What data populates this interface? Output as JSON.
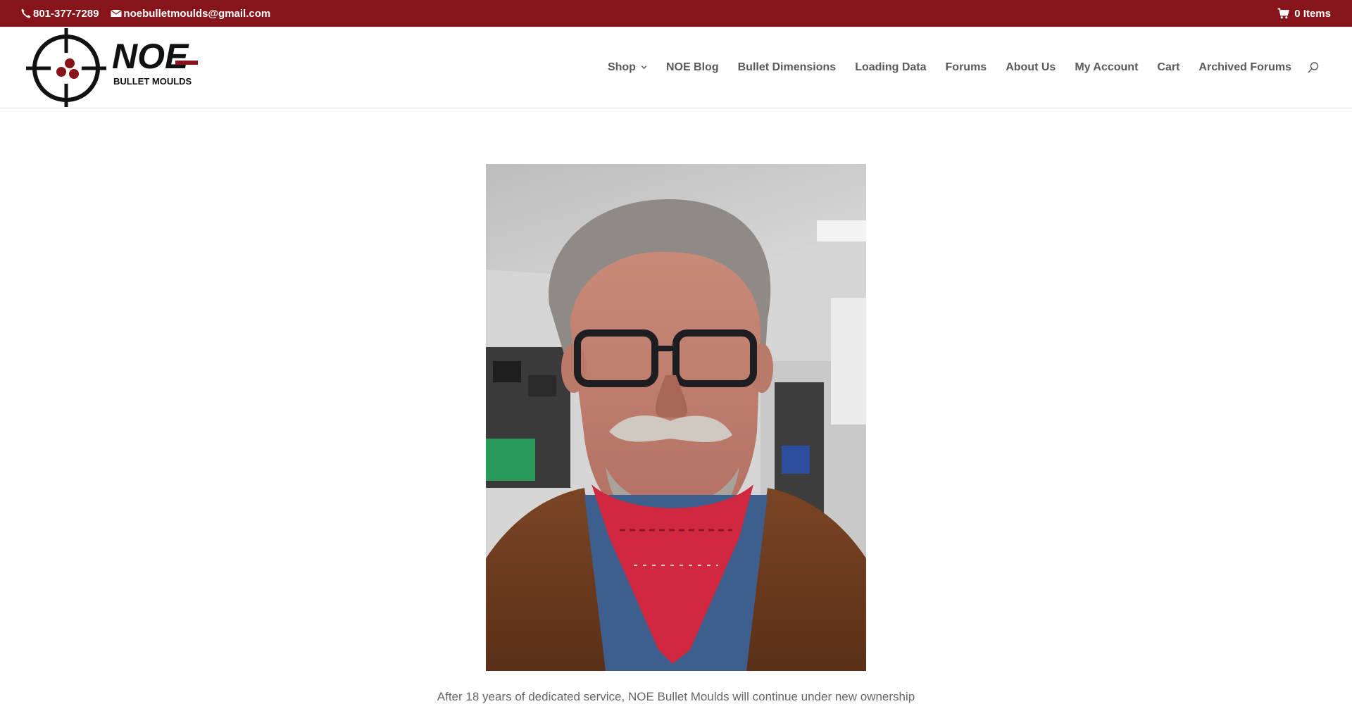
{
  "topbar": {
    "phone": "801-377-7289",
    "email": "noebulletmoulds@gmail.com",
    "cart_label": "0 Items",
    "background": "#86141a"
  },
  "logo": {
    "brand": "NOE",
    "tagline": "BULLET MOULDS"
  },
  "nav": {
    "items": [
      {
        "label": "Shop",
        "has_dropdown": true
      },
      {
        "label": "NOE Blog"
      },
      {
        "label": "Bullet Dimensions"
      },
      {
        "label": "Loading Data"
      },
      {
        "label": "Forums"
      },
      {
        "label": "About Us"
      },
      {
        "label": "My Account"
      },
      {
        "label": "Cart"
      },
      {
        "label": "Archived Forums"
      }
    ],
    "search_icon": "search-icon"
  },
  "content": {
    "photo_subject": "portrait-photo",
    "intro_text": "After 18 years of dedicated service, NOE Bullet Moulds will continue under new ownership"
  },
  "colors": {
    "accent": "#86141a",
    "nav_text": "#5a5a5a"
  }
}
